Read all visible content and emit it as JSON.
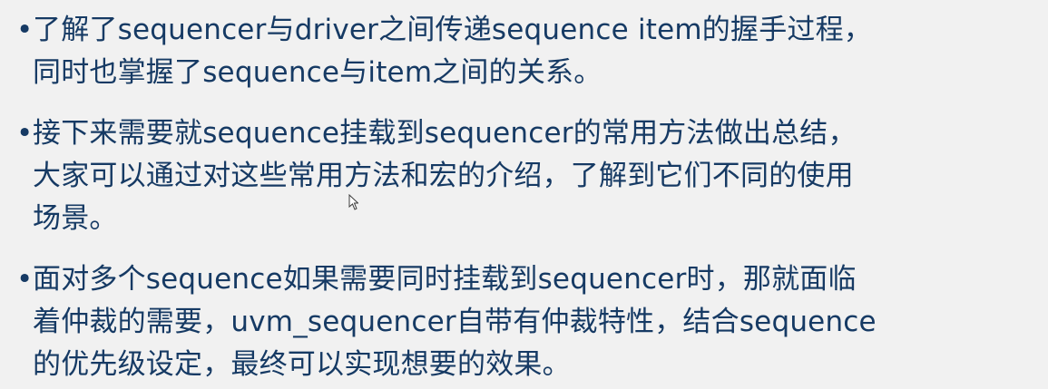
{
  "slide": {
    "bullets": [
      {
        "marker": "•",
        "lines": [
          "了解了sequencer与driver之间传递sequence item的握手过程，",
          "同时也掌握了sequence与item之间的关系。"
        ]
      },
      {
        "marker": "•",
        "lines": [
          "接下来需要就sequence挂载到sequencer的常用方法做出总结，",
          "大家可以通过对这些常用方法和宏的介绍，了解到它们不同的使用",
          "场景。"
        ]
      },
      {
        "marker": "•",
        "lines": [
          "面对多个sequence如果需要同时挂载到sequencer时，那就面临",
          "着仲裁的需要，uvm_sequencer自带有仲裁特性，结合sequence",
          "的优先级设定，最终可以实现想要的效果。"
        ]
      }
    ]
  },
  "colors": {
    "text": "#163a64",
    "background": "#f1f1f1"
  },
  "icons": {
    "cursor": "mouse-cursor-icon"
  }
}
